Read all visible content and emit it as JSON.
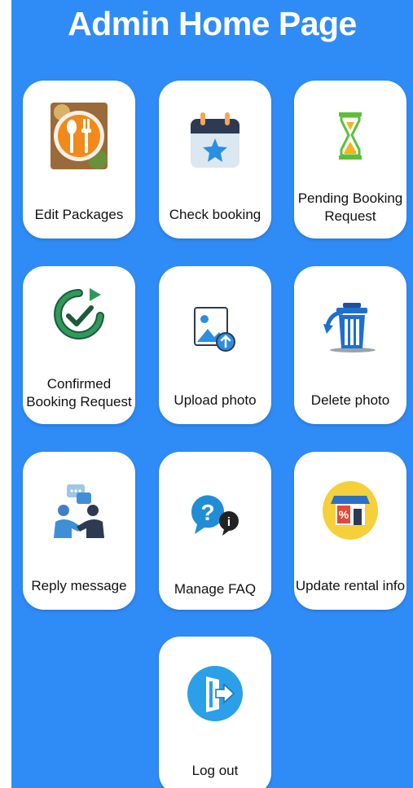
{
  "header": {
    "title": "Admin Home Page"
  },
  "menu": {
    "edit_packages": {
      "label": "Edit Packages",
      "icon": "restaurant-icon"
    },
    "check_booking": {
      "label": "Check booking",
      "icon": "calendar-star-icon"
    },
    "pending_booking": {
      "label": "Pending Booking Request",
      "icon": "hourglass-icon"
    },
    "confirmed_booking": {
      "label": "Confirmed Booking Request",
      "icon": "check-refresh-icon"
    },
    "upload_photo": {
      "label": "Upload photo",
      "icon": "image-upload-icon"
    },
    "delete_photo": {
      "label": "Delete photo",
      "icon": "trash-icon"
    },
    "reply_message": {
      "label": "Reply message",
      "icon": "chat-people-icon"
    },
    "manage_faq": {
      "label": "Manage FAQ",
      "icon": "faq-icon"
    },
    "update_rental": {
      "label": "Update rental info",
      "icon": "shop-icon"
    },
    "log_out": {
      "label": "Log out",
      "icon": "exit-door-icon"
    }
  },
  "colors": {
    "background": "#2f8cf7",
    "card": "#ffffff",
    "title": "#ffffff"
  }
}
